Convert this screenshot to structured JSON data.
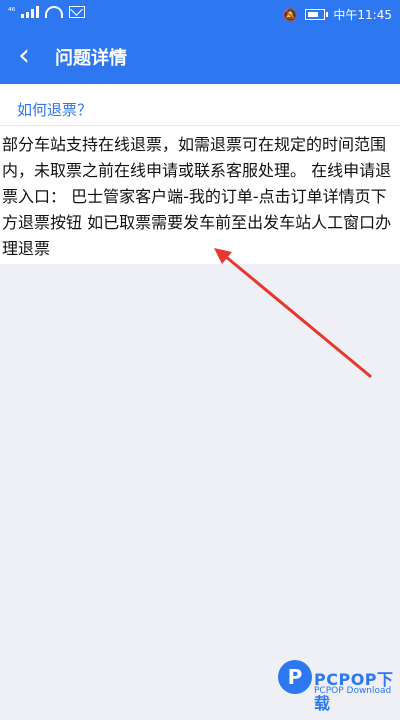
{
  "status_bar": {
    "time": "中午11:45",
    "left_text": "⁴⁶"
  },
  "header": {
    "title": "问题详情",
    "back_symbol": "‹"
  },
  "faq": {
    "question": "如何退票？",
    "answer": "部分车站支持在线退票，如需退票可在规定的时间范围内，未取票之前在线申请或联系客服处理。 在线申请退票入口： 巴士管家客户端-我的订单-点击订单详情页下方退票按钮 如已取票需要发车前至出发车站人工窗口办理退票"
  },
  "watermark": {
    "logo_letter": "P",
    "brand": "PCPOP下载",
    "sub": "PCPOP Download"
  },
  "colors": {
    "header_bg": "#2d77f1",
    "question_color": "#2d77f1",
    "arrow_color": "#e8372f",
    "page_bg": "#eef0f6"
  }
}
